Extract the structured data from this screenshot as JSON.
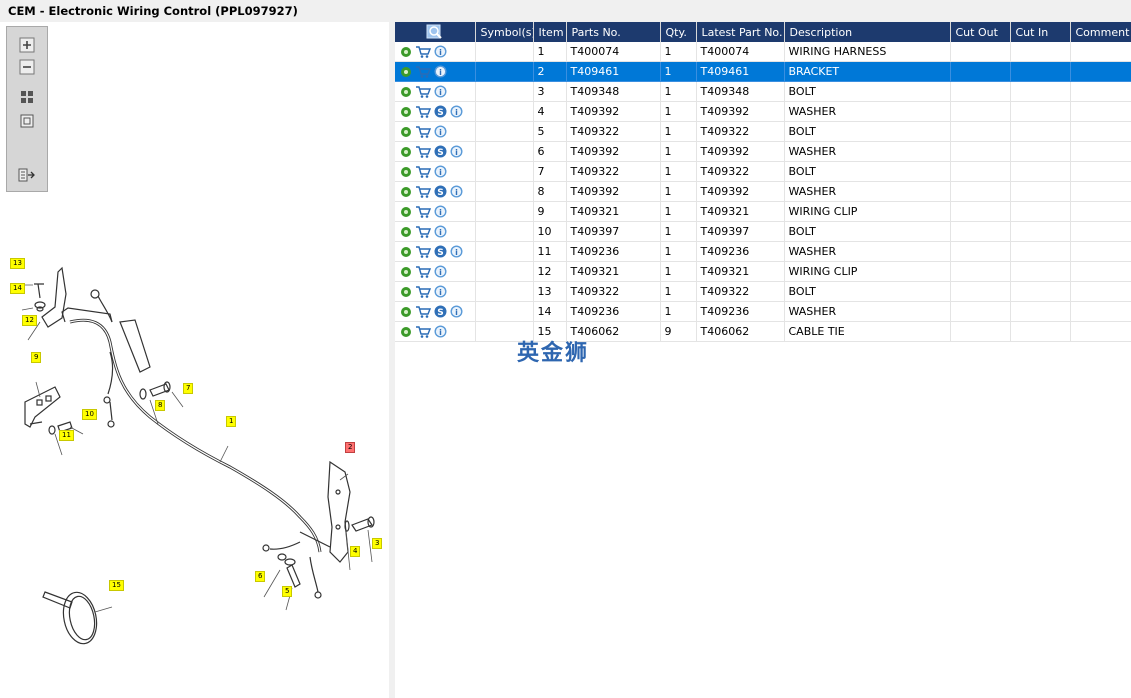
{
  "window": {
    "title": "CEM - Electronic Wiring Control (PPL097927)"
  },
  "table": {
    "columns": [
      "",
      "Symbol(s)",
      "Item",
      "Parts No.",
      "Qty.",
      "Latest Part No.",
      "Description",
      "Cut Out",
      "Cut In",
      "Comment"
    ],
    "rows": [
      {
        "item": "1",
        "part": "T400074",
        "qty": "1",
        "latest": "T400074",
        "desc": "WIRING HARNESS",
        "s": false
      },
      {
        "item": "2",
        "part": "T409461",
        "qty": "1",
        "latest": "T409461",
        "desc": "BRACKET",
        "s": false
      },
      {
        "item": "3",
        "part": "T409348",
        "qty": "1",
        "latest": "T409348",
        "desc": "BOLT",
        "s": false
      },
      {
        "item": "4",
        "part": "T409392",
        "qty": "1",
        "latest": "T409392",
        "desc": "WASHER",
        "s": true
      },
      {
        "item": "5",
        "part": "T409322",
        "qty": "1",
        "latest": "T409322",
        "desc": "BOLT",
        "s": false
      },
      {
        "item": "6",
        "part": "T409392",
        "qty": "1",
        "latest": "T409392",
        "desc": "WASHER",
        "s": true
      },
      {
        "item": "7",
        "part": "T409322",
        "qty": "1",
        "latest": "T409322",
        "desc": "BOLT",
        "s": false
      },
      {
        "item": "8",
        "part": "T409392",
        "qty": "1",
        "latest": "T409392",
        "desc": "WASHER",
        "s": true
      },
      {
        "item": "9",
        "part": "T409321",
        "qty": "1",
        "latest": "T409321",
        "desc": "WIRING CLIP",
        "s": false
      },
      {
        "item": "10",
        "part": "T409397",
        "qty": "1",
        "latest": "T409397",
        "desc": "BOLT",
        "s": false
      },
      {
        "item": "11",
        "part": "T409236",
        "qty": "1",
        "latest": "T409236",
        "desc": "WASHER",
        "s": true
      },
      {
        "item": "12",
        "part": "T409321",
        "qty": "1",
        "latest": "T409321",
        "desc": "WIRING CLIP",
        "s": false
      },
      {
        "item": "13",
        "part": "T409322",
        "qty": "1",
        "latest": "T409322",
        "desc": "BOLT",
        "s": false
      },
      {
        "item": "14",
        "part": "T409236",
        "qty": "1",
        "latest": "T409236",
        "desc": "WASHER",
        "s": true
      },
      {
        "item": "15",
        "part": "T406062",
        "qty": "9",
        "latest": "T406062",
        "desc": "CABLE TIE",
        "s": false
      }
    ],
    "selected_item": "2"
  },
  "diagram": {
    "callouts": [
      "13",
      "14",
      "12",
      "9",
      "10",
      "11",
      "8",
      "7",
      "1",
      "2",
      "3",
      "4",
      "6",
      "5",
      "15"
    ],
    "highlighted_callout": "2"
  },
  "watermark": "英金狮",
  "icons": {
    "toolbox": [
      "zoom-in-icon",
      "zoom-out-icon",
      "fit-all-icon",
      "fit-page-icon",
      "export-icon"
    ],
    "row": [
      "gear-icon",
      "cart-icon",
      "s-badge-icon",
      "info-icon"
    ],
    "header": "search-icon"
  },
  "colors": {
    "header_bg": "#1d3a6e",
    "selected_row": "#0078d7",
    "callout": "#ffff00",
    "callout_highlight": "#ff7070"
  }
}
